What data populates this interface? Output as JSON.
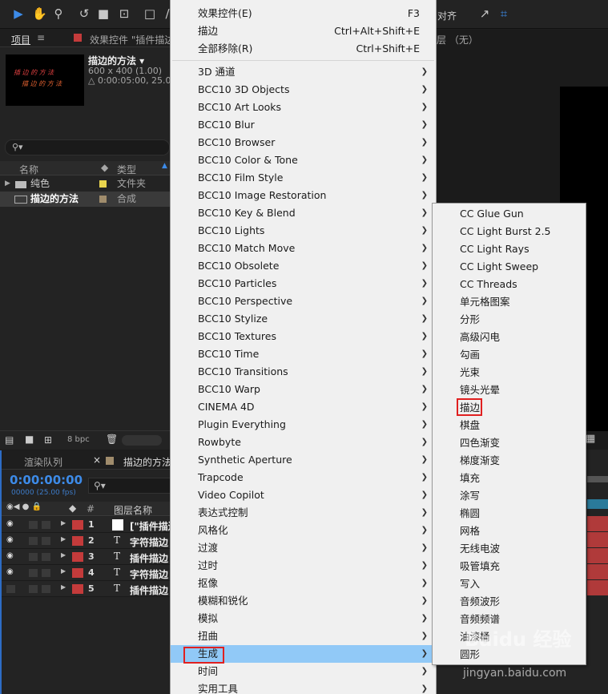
{
  "toolbar": {
    "right_label": "对齐"
  },
  "project_panel": {
    "tab_project": "项目",
    "tab_effects": "效果控件 \"插件描边",
    "comp_name": "描边的方法 ▾",
    "comp_size": "600 x 400 (1.00)",
    "comp_duration": "△ 0:00:05:00, 25.00",
    "thumb_line1": "插 边 的 方 法",
    "thumb_line2": "描 边 的 方 法",
    "col_name": "名称",
    "col_type": "类型",
    "rows": [
      {
        "name": "纯色",
        "type": "文件夹",
        "color": "#e8d44d"
      },
      {
        "name": "描边的方法",
        "type": "合成",
        "color": "#a08c6c"
      }
    ],
    "bpc": "8 bpc"
  },
  "layer_header": "层 （无）",
  "timeline": {
    "tab_render": "渲染队列",
    "tab_comp": "描边的方法",
    "timecode": "0:00:00:00",
    "fps": "00000 (25.00 fps)",
    "col_layer": "图层名称",
    "layers": [
      {
        "num": "1",
        "kind": "solid",
        "name": "[\"插件描边"
      },
      {
        "num": "2",
        "kind": "T",
        "name": "字符描边"
      },
      {
        "num": "3",
        "kind": "T",
        "name": "插件描边"
      },
      {
        "num": "4",
        "kind": "T",
        "name": "字符描边"
      },
      {
        "num": "5",
        "kind": "T",
        "name": "插件描边"
      }
    ]
  },
  "menu": {
    "top_items": [
      {
        "label": "效果控件(E)",
        "shortcut": "F3"
      },
      {
        "label": "描边",
        "shortcut": "Ctrl+Alt+Shift+E"
      },
      {
        "label": "全部移除(R)",
        "shortcut": "Ctrl+Shift+E"
      }
    ],
    "items": [
      "3D 通道",
      "BCC10 3D Objects",
      "BCC10 Art Looks",
      "BCC10 Blur",
      "BCC10 Browser",
      "BCC10 Color & Tone",
      "BCC10 Film Style",
      "BCC10 Image Restoration",
      "BCC10 Key & Blend",
      "BCC10 Lights",
      "BCC10 Match Move",
      "BCC10 Obsolete",
      "BCC10 Particles",
      "BCC10 Perspective",
      "BCC10 Stylize",
      "BCC10 Textures",
      "BCC10 Time",
      "BCC10 Transitions",
      "BCC10 Warp",
      "CINEMA 4D",
      "Plugin Everything",
      "Rowbyte",
      "Synthetic Aperture",
      "Trapcode",
      "Video Copilot",
      "表达式控制",
      "风格化",
      "过渡",
      "过时",
      "抠像",
      "模糊和锐化",
      "模拟",
      "扭曲",
      "生成",
      "时间",
      "实用工具"
    ],
    "highlighted": "生成"
  },
  "submenu": {
    "items": [
      "CC Glue Gun",
      "CC Light Burst 2.5",
      "CC Light Rays",
      "CC Light Sweep",
      "CC Threads",
      "单元格图案",
      "分形",
      "高级闪电",
      "勾画",
      "光束",
      "镜头光晕",
      "描边",
      "棋盘",
      "四色渐变",
      "梯度渐变",
      "填充",
      "涂写",
      "椭圆",
      "网格",
      "无线电波",
      "吸管填充",
      "写入",
      "音频波形",
      "音频频谱",
      "油漆桶",
      "圆形"
    ],
    "marked": "描边"
  },
  "watermark": {
    "logo": "Baidu 经验",
    "url": "jingyan.baidu.com"
  }
}
